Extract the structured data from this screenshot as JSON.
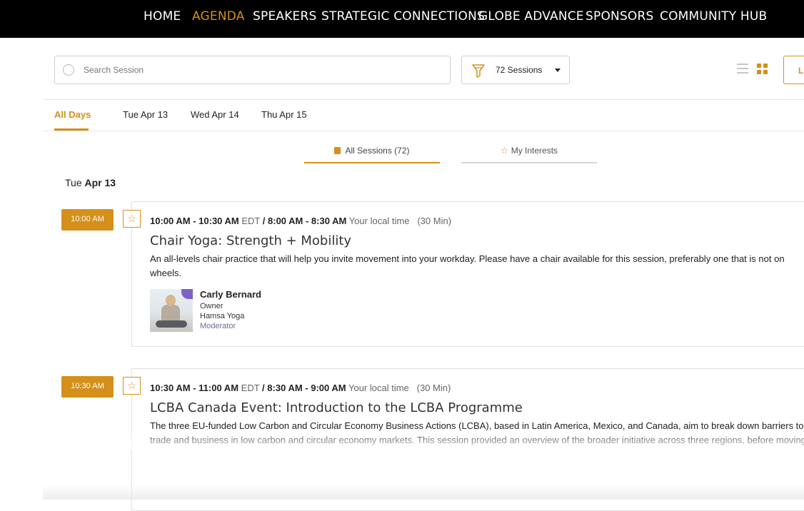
{
  "nav": {
    "items": [
      "HOME",
      "AGENDA",
      "SPEAKERS",
      "STRATEGIC CONNECTIONS",
      "GLOBE ADVANCE",
      "SPONSORS",
      "COMMUNITY HUB"
    ],
    "active": "AGENDA"
  },
  "toolbar": {
    "search_placeholder": "Search Session",
    "filter_label": "72 Sessions",
    "login_label": "LO"
  },
  "day_tabs": [
    "All Days",
    "Tue Apr 13",
    "Wed Apr 14",
    "Thu Apr 15"
  ],
  "session_tabs": {
    "all": "All Sessions (72)",
    "interests": "My Interests"
  },
  "date_heading": {
    "weekday": "Tue",
    "date": "Apr 13"
  },
  "sessions": [
    {
      "pill": "10:00 AM",
      "edt_range": "10:00 AM - 10:30 AM",
      "edt_label": "EDT",
      "local_range": "8:00 AM - 8:30 AM",
      "local_label": "Your local time",
      "duration": "(30 Min)",
      "title": "Chair Yoga: Strength + Mobility",
      "description": "An all-levels chair practice that will help you invite movement into your workday. Please have a chair available for this session, preferably one that is not on wheels.",
      "speaker": {
        "name": "Carly Bernard",
        "title": "Owner",
        "company": "Hamsa Yoga",
        "role": "Moderator"
      }
    },
    {
      "pill": "10:30 AM",
      "edt_range": "10:30 AM - 11:00 AM",
      "edt_label": "EDT",
      "local_range": "8:30 AM - 9:00 AM",
      "local_label": "Your local time",
      "duration": "(30 Min)",
      "title": "LCBA Canada Event: Introduction to the LCBA Programme",
      "description": "The three EU-funded Low Carbon and Circular Economy Business Actions (LCBA), based in Latin America, Mexico, and Canada, aim to break down barriers to trade and business in low carbon and circular economy markets. This session provided an overview of the broader initiative across three regions, before moving"
    }
  ],
  "colors": {
    "accent": "#d4901a",
    "nav_bg": "#000000"
  }
}
